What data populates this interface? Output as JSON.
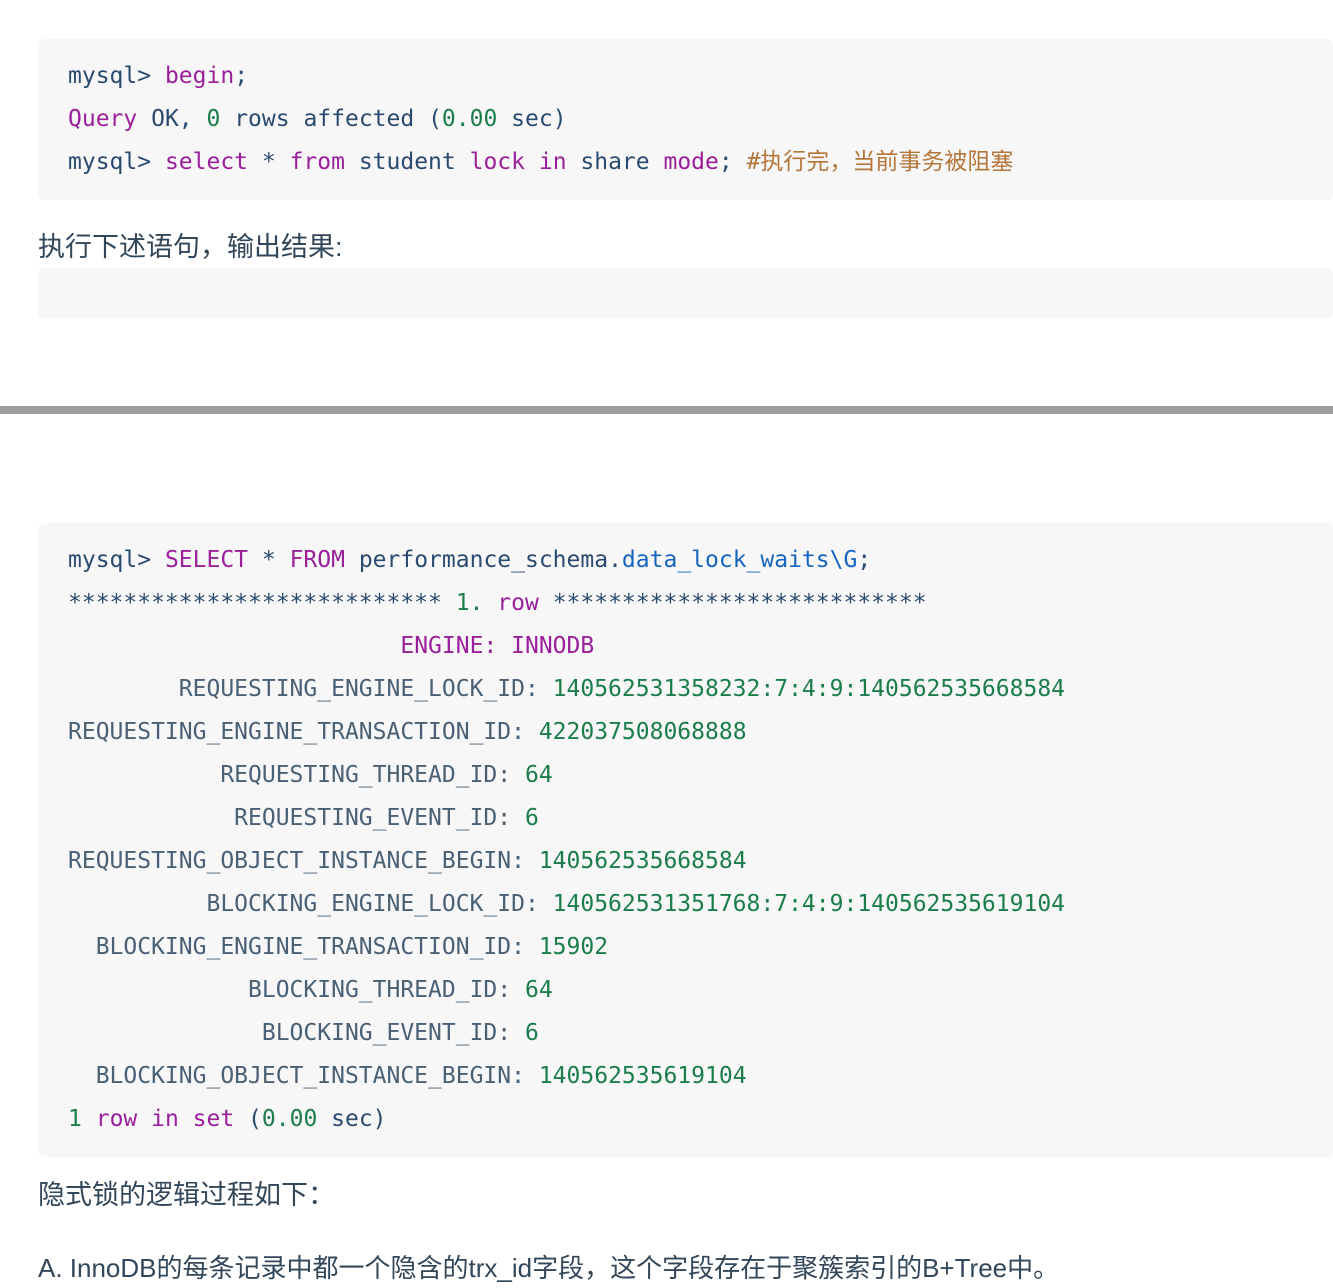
{
  "code_block_1": {
    "name": "mysql-session-transcript",
    "lines": [
      [
        {
          "t": "mysql> ",
          "c": "prompt"
        },
        {
          "t": "begin",
          "c": "kw"
        },
        {
          "t": ";",
          "c": "plain"
        }
      ],
      [
        {
          "t": "Query",
          "c": "kw"
        },
        {
          "t": " OK, ",
          "c": "plain"
        },
        {
          "t": "0",
          "c": "num"
        },
        {
          "t": " rows affected (",
          "c": "plain"
        },
        {
          "t": "0.00",
          "c": "num"
        },
        {
          "t": " sec)",
          "c": "plain"
        }
      ],
      [
        {
          "t": "mysql> ",
          "c": "prompt"
        },
        {
          "t": "select",
          "c": "kw"
        },
        {
          "t": " * ",
          "c": "plain"
        },
        {
          "t": "from",
          "c": "kw"
        },
        {
          "t": " student ",
          "c": "plain"
        },
        {
          "t": "lock",
          "c": "kw"
        },
        {
          "t": " ",
          "c": "plain"
        },
        {
          "t": "in",
          "c": "kw"
        },
        {
          "t": " share ",
          "c": "plain"
        },
        {
          "t": "mode",
          "c": "kw"
        },
        {
          "t": "; ",
          "c": "plain"
        },
        {
          "t": "#执行完，当前事务被阻塞",
          "c": "comment"
        }
      ]
    ]
  },
  "code_block_empty": {
    "name": "empty-output-block",
    "lines": []
  },
  "code_block_2": {
    "name": "data-lock-waits-output",
    "lines": [
      [
        {
          "t": "mysql> ",
          "c": "prompt"
        },
        {
          "t": "SELECT",
          "c": "kw"
        },
        {
          "t": " * ",
          "c": "plain"
        },
        {
          "t": "FROM",
          "c": "kw"
        },
        {
          "t": " performance_schema.",
          "c": "plain"
        },
        {
          "t": "data_lock_waits\\G",
          "c": "ident"
        },
        {
          "t": ";",
          "c": "plain"
        }
      ],
      [
        {
          "t": "*************************** ",
          "c": "stars"
        },
        {
          "t": "1.",
          "c": "num"
        },
        {
          "t": " ",
          "c": "plain"
        },
        {
          "t": "row",
          "c": "kw"
        },
        {
          "t": " ***************************",
          "c": "stars"
        }
      ],
      [
        {
          "t": "                        ",
          "c": "plain"
        },
        {
          "t": "ENGINE: INNODB",
          "c": "kw"
        }
      ],
      [
        {
          "t": "        REQUESTING_ENGINE_LOCK_ID:",
          "c": "field"
        },
        {
          "t": " ",
          "c": "plain"
        },
        {
          "t": "140562531358232:7:4:9:140562535668584",
          "c": "str"
        }
      ],
      [
        {
          "t": "REQUESTING_ENGINE_TRANSACTION_ID:",
          "c": "field"
        },
        {
          "t": " ",
          "c": "plain"
        },
        {
          "t": "422037508068888",
          "c": "str"
        }
      ],
      [
        {
          "t": "           REQUESTING_THREAD_ID:",
          "c": "field"
        },
        {
          "t": " ",
          "c": "plain"
        },
        {
          "t": "64",
          "c": "str"
        }
      ],
      [
        {
          "t": "            REQUESTING_EVENT_ID:",
          "c": "field"
        },
        {
          "t": " ",
          "c": "plain"
        },
        {
          "t": "6",
          "c": "str"
        }
      ],
      [
        {
          "t": "REQUESTING_OBJECT_INSTANCE_BEGIN:",
          "c": "field"
        },
        {
          "t": " ",
          "c": "plain"
        },
        {
          "t": "140562535668584",
          "c": "str"
        }
      ],
      [
        {
          "t": "          BLOCKING_ENGINE_LOCK_ID:",
          "c": "field"
        },
        {
          "t": " ",
          "c": "plain"
        },
        {
          "t": "140562531351768:7:4:9:140562535619104",
          "c": "str"
        }
      ],
      [
        {
          "t": "  BLOCKING_ENGINE_TRANSACTION_ID:",
          "c": "field"
        },
        {
          "t": " ",
          "c": "plain"
        },
        {
          "t": "15902",
          "c": "str"
        }
      ],
      [
        {
          "t": "             BLOCKING_THREAD_ID:",
          "c": "field"
        },
        {
          "t": " ",
          "c": "plain"
        },
        {
          "t": "64",
          "c": "str"
        }
      ],
      [
        {
          "t": "              BLOCKING_EVENT_ID:",
          "c": "field"
        },
        {
          "t": " ",
          "c": "plain"
        },
        {
          "t": "6",
          "c": "str"
        }
      ],
      [
        {
          "t": "  BLOCKING_OBJECT_INSTANCE_BEGIN:",
          "c": "field"
        },
        {
          "t": " ",
          "c": "plain"
        },
        {
          "t": "140562535619104",
          "c": "str"
        }
      ],
      [
        {
          "t": "1",
          "c": "num"
        },
        {
          "t": " ",
          "c": "plain"
        },
        {
          "t": "row in set",
          "c": "kw"
        },
        {
          "t": " (",
          "c": "plain"
        },
        {
          "t": "0.00",
          "c": "num"
        },
        {
          "t": " sec)",
          "c": "plain"
        }
      ]
    ]
  },
  "prose": {
    "para_1": "执行下述语句，输出结果:",
    "para_2": "隐式锁的逻辑过程如下：",
    "para_3": "A. InnoDB的每条记录中都一个隐含的trx_id字段，这个字段存在于聚簇索引的B+Tree中。"
  },
  "colors": {
    "code_background": "#f7f7f8",
    "prompt": "#2b4a6f",
    "keyword": "#9a1f9a",
    "number": "#1a7d4a",
    "string": "#1a7d4a",
    "comment": "#b5763a",
    "identifier": "#1565c0",
    "field": "#4a6075",
    "prose_text": "#33475b",
    "separator": "#9e9e9e"
  }
}
